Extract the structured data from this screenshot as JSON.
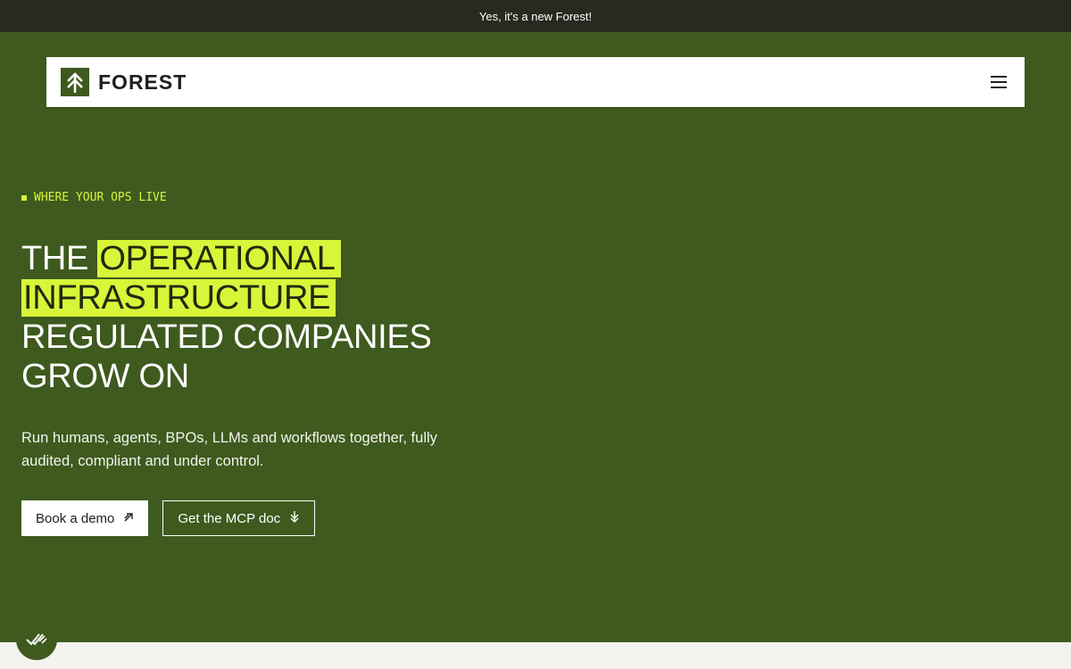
{
  "announcement": {
    "text": "Yes, it's a new Forest!"
  },
  "nav": {
    "brand": "FOREST",
    "menu_icon": "hamburger-menu-icon",
    "logo_icon": "forest-arrow-logo-icon"
  },
  "hero": {
    "eyebrow": "WHERE YOUR OPS LIVE",
    "headline": {
      "line1_plain": "THE ",
      "line1_highlight": "OPERATIONAL",
      "line2_highlight": "INFRASTRUCTURE",
      "line3": "REGULATED COMPANIES",
      "line4": "GROW ON"
    },
    "subtext": "Run humans, agents, BPOs, LLMs and workflows together, fully audited, compliant and under control.",
    "cta_primary": {
      "label": "Book a demo",
      "icon": "arrow-up-right-icon"
    },
    "cta_secondary": {
      "label": "Get the MCP doc",
      "icon": "arrow-down-icon"
    }
  },
  "colors": {
    "brand_green": "#3e5a1e",
    "accent_lime": "#d8f53a",
    "announce_bg": "#262a1f",
    "bottom_band": "#f4f3ef"
  },
  "badge": {
    "icon": "double-check-icon"
  }
}
